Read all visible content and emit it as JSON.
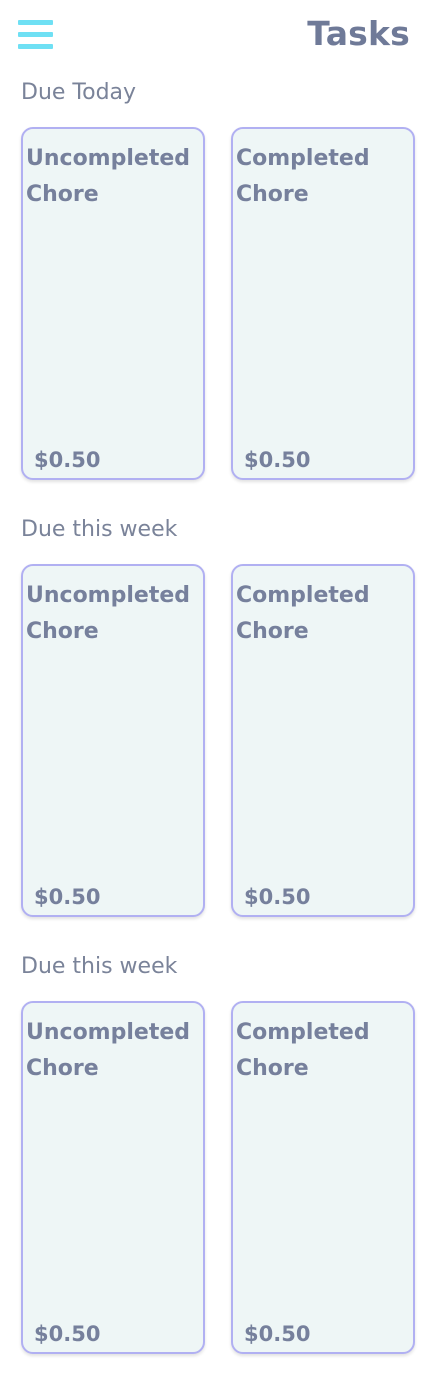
{
  "header": {
    "title": "Tasks",
    "menu_icon": "hamburger-menu-icon",
    "menu_color": "#6fe0f4"
  },
  "sections": [
    {
      "title": "Due Today",
      "cards": [
        {
          "title": "Uncompleted Chore",
          "price": "$0.50"
        },
        {
          "title": "Completed Chore",
          "price": "$0.50"
        }
      ]
    },
    {
      "title": "Due this week",
      "cards": [
        {
          "title": "Uncompleted Chore",
          "price": "$0.50"
        },
        {
          "title": "Completed Chore",
          "price": "$0.50"
        }
      ]
    },
    {
      "title": "Due this week",
      "cards": [
        {
          "title": "Uncompleted Chore",
          "price": "$0.50"
        },
        {
          "title": "Completed Chore",
          "price": "$0.50"
        }
      ]
    }
  ],
  "colors": {
    "card_background": "#eef6f6",
    "card_border": "#b1b0f2",
    "text": "#76809c"
  }
}
